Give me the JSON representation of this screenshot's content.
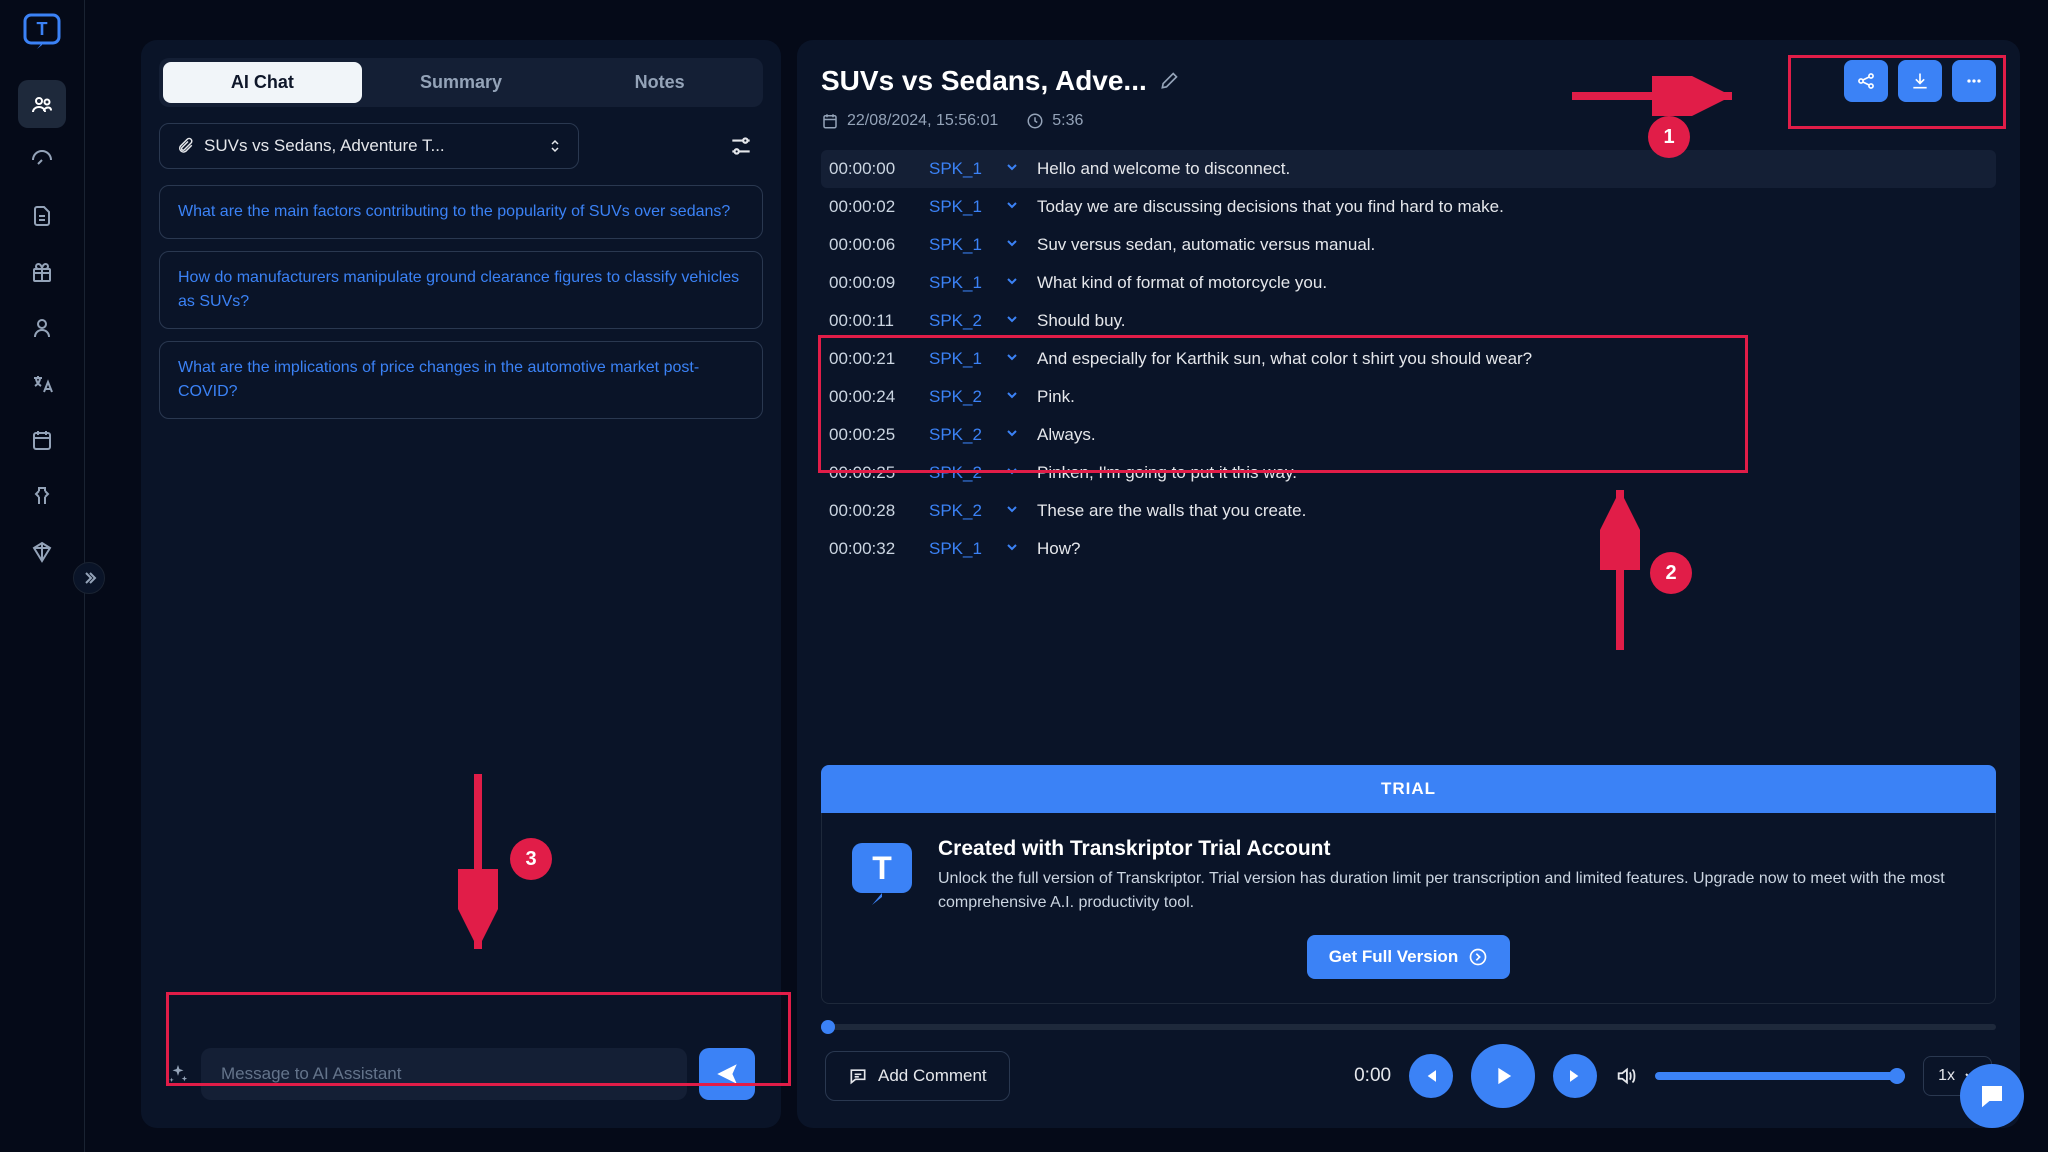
{
  "tabs": {
    "ai_chat": "AI Chat",
    "summary": "Summary",
    "notes": "Notes"
  },
  "file_name": "SUVs vs Sedans, Adventure T...",
  "questions": [
    "What are the main factors contributing to the popularity of SUVs over sedans?",
    "How do manufacturers manipulate ground clearance figures to classify vehicles as SUVs?",
    "What are the implications of price changes in the automotive market post-COVID?"
  ],
  "chat_placeholder": "Message to AI Assistant",
  "title": "SUVs vs Sedans, Adve...",
  "date": "22/08/2024, 15:56:01",
  "duration": "5:36",
  "transcript": [
    {
      "ts": "00:00:00",
      "spk": "SPK_1",
      "text": "Hello and welcome to disconnect."
    },
    {
      "ts": "00:00:02",
      "spk": "SPK_1",
      "text": "Today we are discussing decisions that you find hard to make."
    },
    {
      "ts": "00:00:06",
      "spk": "SPK_1",
      "text": "Suv versus sedan, automatic versus manual."
    },
    {
      "ts": "00:00:09",
      "spk": "SPK_1",
      "text": "What kind of format of motorcycle you."
    },
    {
      "ts": "00:00:11",
      "spk": "SPK_2",
      "text": "Should buy."
    },
    {
      "ts": "00:00:21",
      "spk": "SPK_1",
      "text": "And especially for Karthik sun, what color t shirt you should wear?"
    },
    {
      "ts": "00:00:24",
      "spk": "SPK_2",
      "text": "Pink."
    },
    {
      "ts": "00:00:25",
      "spk": "SPK_2",
      "text": "Always."
    },
    {
      "ts": "00:00:25",
      "spk": "SPK_2",
      "text": "Pinken, I'm going to put it this way."
    },
    {
      "ts": "00:00:28",
      "spk": "SPK_2",
      "text": "These are the walls that you create."
    },
    {
      "ts": "00:00:32",
      "spk": "SPK_1",
      "text": "How?"
    }
  ],
  "trial": {
    "banner": "TRIAL",
    "title": "Created with Transkriptor Trial Account",
    "body": "Unlock the full version of Transkriptor. Trial version has duration limit per transcription and limited features. Upgrade now to meet with the most comprehensive A.I. productivity tool.",
    "cta": "Get Full Version"
  },
  "player": {
    "comment": "Add Comment",
    "time": "0:00",
    "speed": "1x"
  },
  "annotations": {
    "a1": "1",
    "a2": "2",
    "a3": "3"
  }
}
